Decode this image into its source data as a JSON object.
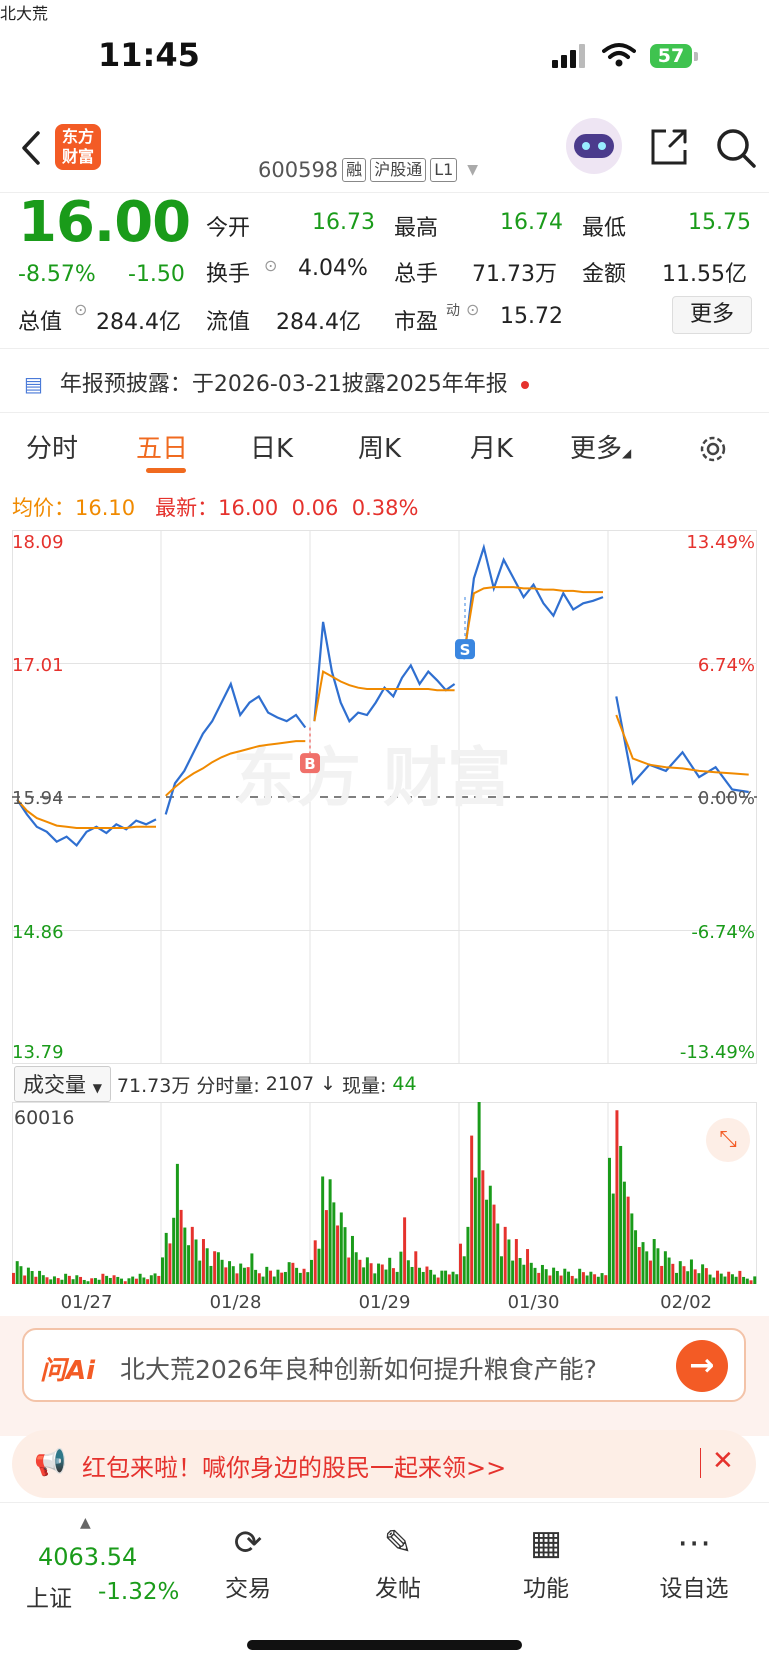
{
  "status_bar": {
    "time": "11:45",
    "battery": "57"
  },
  "header": {
    "logo_text": "东方\n财富",
    "stock_name": "北大荒",
    "code": "600598",
    "tags": [
      "融",
      "沪股通",
      "L1"
    ]
  },
  "quote": {
    "price": "16.00",
    "change_pct": "-8.57%",
    "change": "-1.50",
    "open_label": "今开",
    "open": "16.73",
    "high_label": "最高",
    "high": "16.74",
    "low_label": "最低",
    "low": "15.75",
    "turnover_label": "换手",
    "turnover": "4.04%",
    "volume_label": "总手",
    "volume": "71.73万",
    "amount_label": "金额",
    "amount": "11.55亿",
    "mktcap_label": "总值",
    "mktcap": "284.4亿",
    "float_label": "流值",
    "float_cap": "284.4亿",
    "pe_label": "市盈",
    "pe_sup": "动",
    "pe": "15.72",
    "more_label": "更多"
  },
  "notice": {
    "text": "年报预披露：于2026-03-21披露2025年年报"
  },
  "tabs": [
    "分时",
    "五日",
    "日K",
    "周K",
    "月K",
    "更多"
  ],
  "active_tab": "五日",
  "legend": {
    "avg_label": "均价：",
    "avg": "16.10",
    "latest_label": "最新：",
    "latest": "16.00",
    "latest_chg": "0.06",
    "latest_pct": "0.38%"
  },
  "chart_data": {
    "type": "line",
    "x_labels": [
      "01/27",
      "01/28",
      "01/29",
      "01/30",
      "02/02"
    ],
    "price_axis": [
      "18.09",
      "17.01",
      "15.94",
      "14.86",
      "13.79"
    ],
    "pct_axis": [
      "13.49%",
      "6.74%",
      "0.00%",
      "-6.74%",
      "-13.49%"
    ],
    "ylim": [
      13.79,
      18.09
    ],
    "prev_close": 15.94,
    "series": [
      {
        "color": "#2f6fd0",
        "days": [
          [
            15.92,
            15.8,
            15.7,
            15.66,
            15.58,
            15.62,
            15.55,
            15.66,
            15.7,
            15.65,
            15.72,
            15.68,
            15.75,
            15.72,
            15.76
          ],
          [
            15.8,
            16.05,
            16.15,
            16.3,
            16.45,
            16.55,
            16.7,
            16.85,
            16.6,
            16.7,
            16.75,
            16.62,
            16.58,
            16.55,
            16.6,
            16.5
          ],
          [
            16.55,
            17.35,
            16.95,
            16.7,
            16.55,
            16.62,
            16.6,
            16.7,
            16.82,
            16.75,
            16.9,
            17.0,
            16.85,
            16.95,
            16.88,
            16.8,
            16.85
          ],
          [
            17.05,
            17.7,
            17.95,
            17.62,
            17.85,
            17.7,
            17.55,
            17.65,
            17.5,
            17.4,
            17.58,
            17.45,
            17.5,
            17.52,
            17.55
          ],
          [
            16.75,
            16.05,
            16.2,
            16.15,
            16.3,
            16.1,
            16.18,
            16.0,
            15.98
          ]
        ]
      },
      {
        "color": "#f08a00",
        "days": [
          [
            15.92,
            15.83,
            15.77,
            15.74,
            15.71,
            15.7,
            15.69,
            15.69,
            15.69,
            15.69,
            15.69,
            15.69,
            15.7,
            15.7,
            15.7
          ],
          [
            15.95,
            16.02,
            16.08,
            16.13,
            16.17,
            16.22,
            16.26,
            16.29,
            16.31,
            16.33,
            16.35,
            16.36,
            16.37,
            16.38,
            16.39,
            16.39
          ],
          [
            16.55,
            16.95,
            16.91,
            16.87,
            16.84,
            16.82,
            16.81,
            16.81,
            16.81,
            16.81,
            16.81,
            16.81,
            16.81,
            16.81,
            16.8,
            16.8,
            16.8
          ],
          [
            17.1,
            17.58,
            17.62,
            17.63,
            17.63,
            17.63,
            17.62,
            17.62,
            17.61,
            17.61,
            17.6,
            17.6,
            17.59,
            17.59,
            17.59
          ],
          [
            16.6,
            16.25,
            16.2,
            16.18,
            16.17,
            16.15,
            16.14,
            16.13,
            16.12
          ]
        ]
      }
    ],
    "trades": [
      {
        "label": "B",
        "day": 1
      },
      {
        "label": "S",
        "day": 3
      }
    ],
    "volume": {
      "label": "成交量",
      "total": "71.73万",
      "minute_label": "分时量:",
      "minute": "2107",
      "arrow": "↓",
      "current_label": "现量:",
      "current": "44",
      "max": "60016",
      "days": [
        [
          0.12,
          0.08,
          0.06,
          0.05,
          0.04,
          0.05,
          0.04,
          0.03,
          0.04,
          0.05,
          0.04,
          0.03,
          0.05,
          0.04,
          0.06
        ],
        [
          0.25,
          0.55,
          0.42,
          0.3,
          0.22,
          0.15,
          0.18,
          0.12,
          0.1,
          0.14,
          0.08,
          0.09,
          0.07,
          0.1,
          0.12,
          0.08
        ],
        [
          0.2,
          0.8,
          0.55,
          0.35,
          0.22,
          0.18,
          0.14,
          0.1,
          0.12,
          0.09,
          0.35,
          0.16,
          0.1,
          0.08,
          0.07,
          0.09,
          0.06
        ],
        [
          0.3,
          1.0,
          0.7,
          0.45,
          0.3,
          0.22,
          0.16,
          0.12,
          0.1,
          0.08,
          0.07,
          0.06,
          0.08,
          0.06,
          0.05
        ],
        [
          0.85,
          0.4,
          0.22,
          0.15,
          0.12,
          0.09,
          0.07,
          0.06,
          0.04
        ]
      ]
    }
  },
  "ask_ai": {
    "logo": "问Ai",
    "text": "北大荒2026年良种创新如何提升粮食产能?"
  },
  "banner": {
    "text": "红包来啦！喊你身边的股民一起来领>>"
  },
  "bottom_nav": {
    "index_value": "4063.54",
    "index_name": "上证",
    "index_pct": "-1.32%",
    "items": [
      "交易",
      "发帖",
      "功能",
      "设自选"
    ]
  }
}
